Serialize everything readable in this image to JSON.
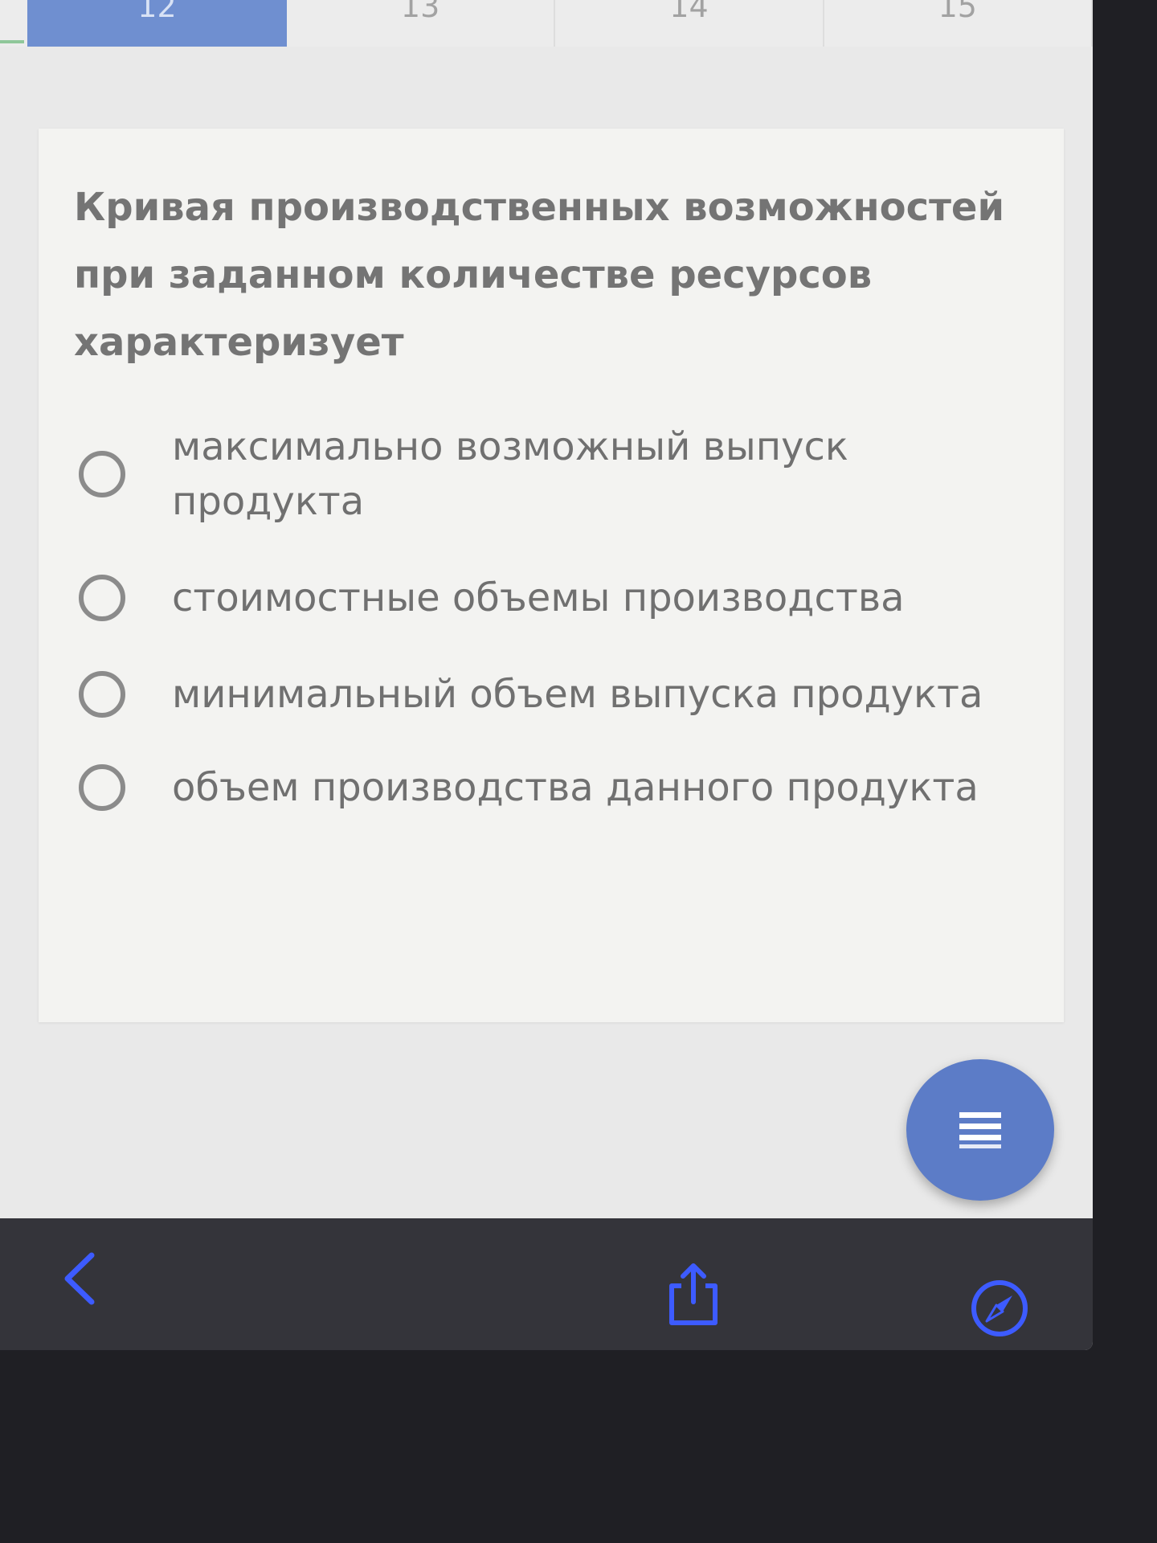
{
  "tabs": [
    {
      "label": "12",
      "active": true
    },
    {
      "label": "13",
      "active": false
    },
    {
      "label": "14",
      "active": false
    },
    {
      "label": "15",
      "active": false
    }
  ],
  "question": {
    "text": "Кривая производственных возможностей при заданном количестве ресурсов характеризует"
  },
  "options": [
    {
      "label": "максимально возможный выпуск продукта",
      "selected": false
    },
    {
      "label": "стоимостные объемы производства",
      "selected": false
    },
    {
      "label": "минимальный объем выпуска продукта",
      "selected": false
    },
    {
      "label": "объем производства данного продукта",
      "selected": false
    }
  ],
  "fab": {
    "icon": "menu-icon"
  },
  "browser_toolbar": {
    "icons": [
      "back-arrow-icon",
      "share-icon",
      "compass-icon"
    ]
  },
  "colors": {
    "accent": "#5c7cc7",
    "toolbar_icon": "#3d5bff",
    "text": "#747474"
  }
}
